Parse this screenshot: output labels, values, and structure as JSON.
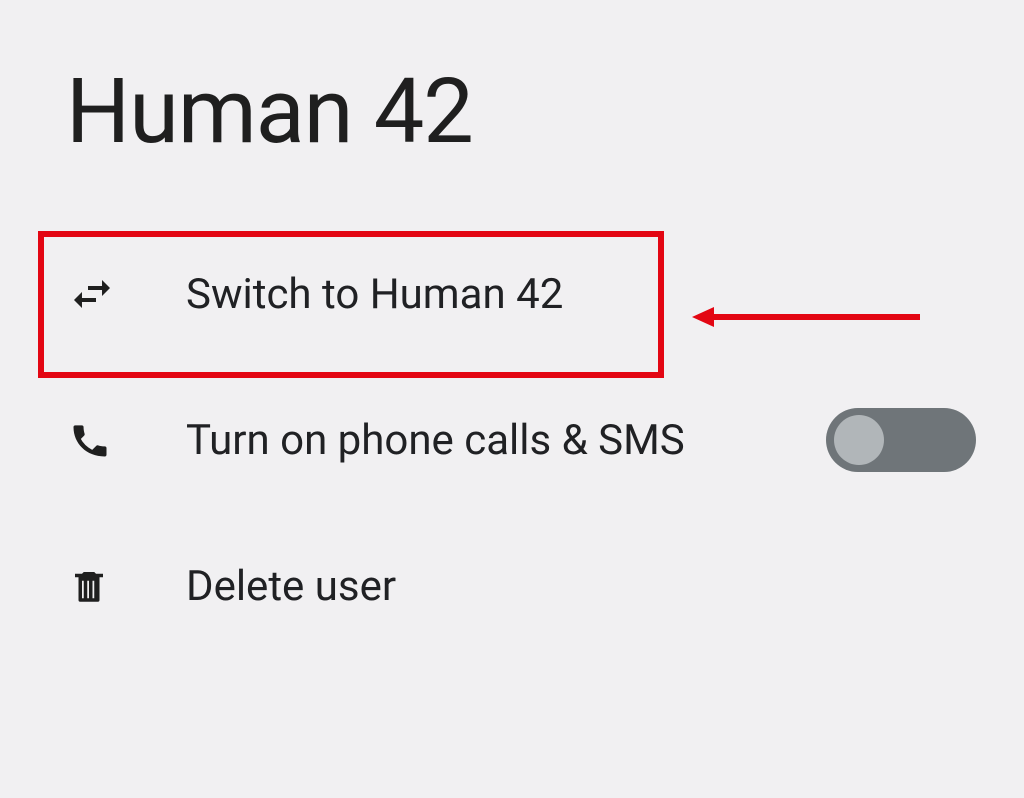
{
  "title": "Human 42",
  "rows": {
    "switch": {
      "label": "Switch to Human 42"
    },
    "calls": {
      "label": "Turn on phone calls & SMS",
      "toggle_on": false
    },
    "delete": {
      "label": "Delete user"
    }
  },
  "colors": {
    "highlight": "#e30613",
    "toggle_track_off": "#6f7579",
    "toggle_knob_off": "#b1b6b9",
    "icon": "#5f6368",
    "text": "#202124",
    "background": "#f1f0f2"
  }
}
